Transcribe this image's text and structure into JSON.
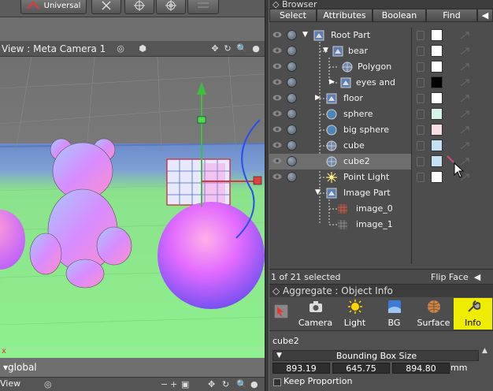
{
  "toolbar": {
    "universal_label": "Universal"
  },
  "viewport": {
    "title": "View : Meta Camera 1",
    "footer_left": "View",
    "coord_space": "global",
    "axis_label": "x"
  },
  "browser": {
    "title": "Browser",
    "menu": [
      "Select",
      "Attributes",
      "Boolean",
      "Find"
    ],
    "status": "1 of 21 selected",
    "flip_face": "Flip Face",
    "nodes": [
      {
        "label": "Root Part",
        "color": "#ffffff"
      },
      {
        "label": "bear",
        "color": "#ffffff"
      },
      {
        "label": "Polygon",
        "color": "#ffffff"
      },
      {
        "label": "eyes and",
        "color": "#000000"
      },
      {
        "label": "floor",
        "color": "#ffffff"
      },
      {
        "label": "sphere",
        "color": "#d5f3e6"
      },
      {
        "label": "big sphere",
        "color": "#f6dfe3"
      },
      {
        "label": "cube",
        "color": "#c6e1f2"
      },
      {
        "label": "cube2",
        "color": "#c6e1f2"
      },
      {
        "label": "Point Light",
        "color": "#ffffff"
      },
      {
        "label": "Image Part",
        "color": null
      },
      {
        "label": "image_0",
        "color": null
      },
      {
        "label": "image_1",
        "color": null
      }
    ]
  },
  "aggregate": {
    "title": "Aggregate : Object Info",
    "tabs": [
      "Camera",
      "Light",
      "BG",
      "Surface",
      "Info"
    ],
    "object_name": "cube2",
    "bbox_title": "Bounding Box Size",
    "bbox": {
      "x": "893.19",
      "y": "645.75",
      "z": "894.80"
    },
    "unit": "mm",
    "keep_proportion": "Keep Proportion"
  }
}
